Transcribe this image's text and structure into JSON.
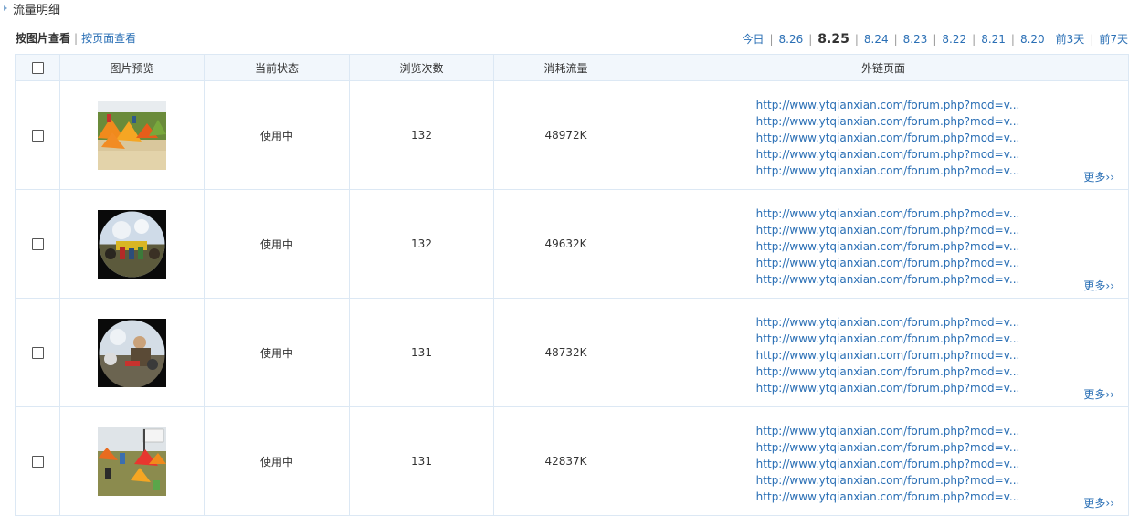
{
  "header": {
    "title": "流量明细"
  },
  "view_tabs": {
    "by_image": "按图片查看",
    "separator": "|",
    "by_page": "按页面查看"
  },
  "date_filter": {
    "today": "今日",
    "d826": "8.26",
    "d825": "8.25",
    "d824": "8.24",
    "d823": "8.23",
    "d822": "8.22",
    "d821": "8.21",
    "d820": "8.20",
    "prev3": "前3天",
    "prev7": "前7天",
    "separator": "|",
    "selected": "8.25"
  },
  "table": {
    "headers": {
      "preview": "图片预览",
      "status": "当前状态",
      "views": "浏览次数",
      "traffic": "消耗流量",
      "ref_pages": "外链页面"
    },
    "rows": [
      {
        "status": "使用中",
        "views": "132",
        "traffic": "48972K",
        "thumb": "tents-yellow-icon",
        "links": [
          "http://www.ytqianxian.com/forum.php?mod=v...",
          "http://www.ytqianxian.com/forum.php?mod=v...",
          "http://www.ytqianxian.com/forum.php?mod=v...",
          "http://www.ytqianxian.com/forum.php?mod=v...",
          "http://www.ytqianxian.com/forum.php?mod=v..."
        ],
        "more": "更多››"
      },
      {
        "status": "使用中",
        "views": "132",
        "traffic": "49632K",
        "thumb": "fisheye-crowd-icon",
        "links": [
          "http://www.ytqianxian.com/forum.php?mod=v...",
          "http://www.ytqianxian.com/forum.php?mod=v...",
          "http://www.ytqianxian.com/forum.php?mod=v...",
          "http://www.ytqianxian.com/forum.php?mod=v...",
          "http://www.ytqianxian.com/forum.php?mod=v..."
        ],
        "more": "更多››"
      },
      {
        "status": "使用中",
        "views": "131",
        "traffic": "48732K",
        "thumb": "fisheye-person-icon",
        "links": [
          "http://www.ytqianxian.com/forum.php?mod=v...",
          "http://www.ytqianxian.com/forum.php?mod=v...",
          "http://www.ytqianxian.com/forum.php?mod=v...",
          "http://www.ytqianxian.com/forum.php?mod=v...",
          "http://www.ytqianxian.com/forum.php?mod=v..."
        ],
        "more": "更多››"
      },
      {
        "status": "使用中",
        "views": "131",
        "traffic": "42837K",
        "thumb": "tents-flag-icon",
        "links": [
          "http://www.ytqianxian.com/forum.php?mod=v...",
          "http://www.ytqianxian.com/forum.php?mod=v...",
          "http://www.ytqianxian.com/forum.php?mod=v...",
          "http://www.ytqianxian.com/forum.php?mod=v...",
          "http://www.ytqianxian.com/forum.php?mod=v..."
        ],
        "more": "更多››"
      }
    ]
  },
  "colors": {
    "link": "#2a6fb5",
    "border": "#dce8f4",
    "header_bg": "#f2f7fc",
    "text": "#333333"
  }
}
